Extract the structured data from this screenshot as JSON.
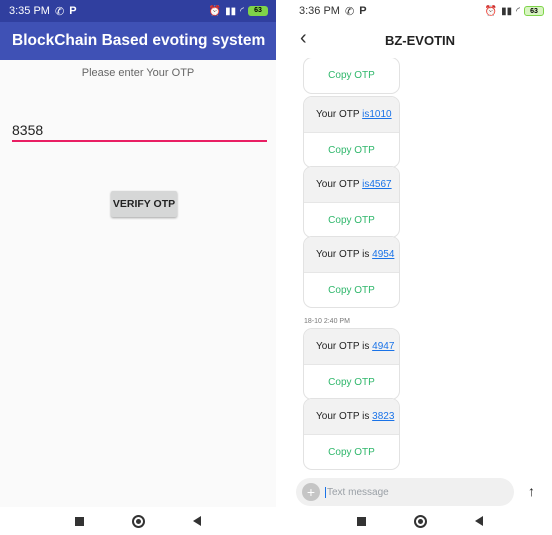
{
  "left_screen": {
    "status_time": "3:35 PM",
    "status_app_label": "P",
    "battery_level": "63",
    "app_title": "BlockChain Based evoting system",
    "prompt": "Please enter Your OTP",
    "otp_value": "8358",
    "verify_button": "VERIFY OTP"
  },
  "right_screen": {
    "status_time": "3:36 PM",
    "status_app_label": "P",
    "battery_level": "63",
    "thread_title": "BZ-EVOTIN",
    "messages": [
      {
        "prefix": "Your OTP ",
        "otp": "is1010",
        "action": "Copy OTP"
      },
      {
        "prefix": "Your OTP ",
        "otp": "is4567",
        "action": "Copy OTP"
      },
      {
        "prefix": "Your OTP is ",
        "otp": "4954",
        "action": "Copy OTP"
      },
      {
        "prefix": "Your OTP is ",
        "otp": "4947",
        "action": "Copy OTP"
      },
      {
        "prefix": "Your OTP is ",
        "otp": "3823",
        "action": "Copy OTP"
      }
    ],
    "visible_copy": "Copy OTP",
    "timestamp": "18-10 2:40 PM",
    "composer_placeholder": "Text message"
  },
  "colors": {
    "status_bar": "#303f9f",
    "app_bar": "#3f51b5",
    "input_underline": "#e91e63",
    "otp_link": "#1a73e8",
    "copy_otp": "#2fb76b"
  },
  "icons": [
    "whatsapp-icon",
    "signal-icon",
    "wifi-icon",
    "battery-icon",
    "back-icon",
    "plus-icon",
    "send-icon",
    "nav-recent-icon",
    "nav-home-icon",
    "nav-back-icon"
  ]
}
